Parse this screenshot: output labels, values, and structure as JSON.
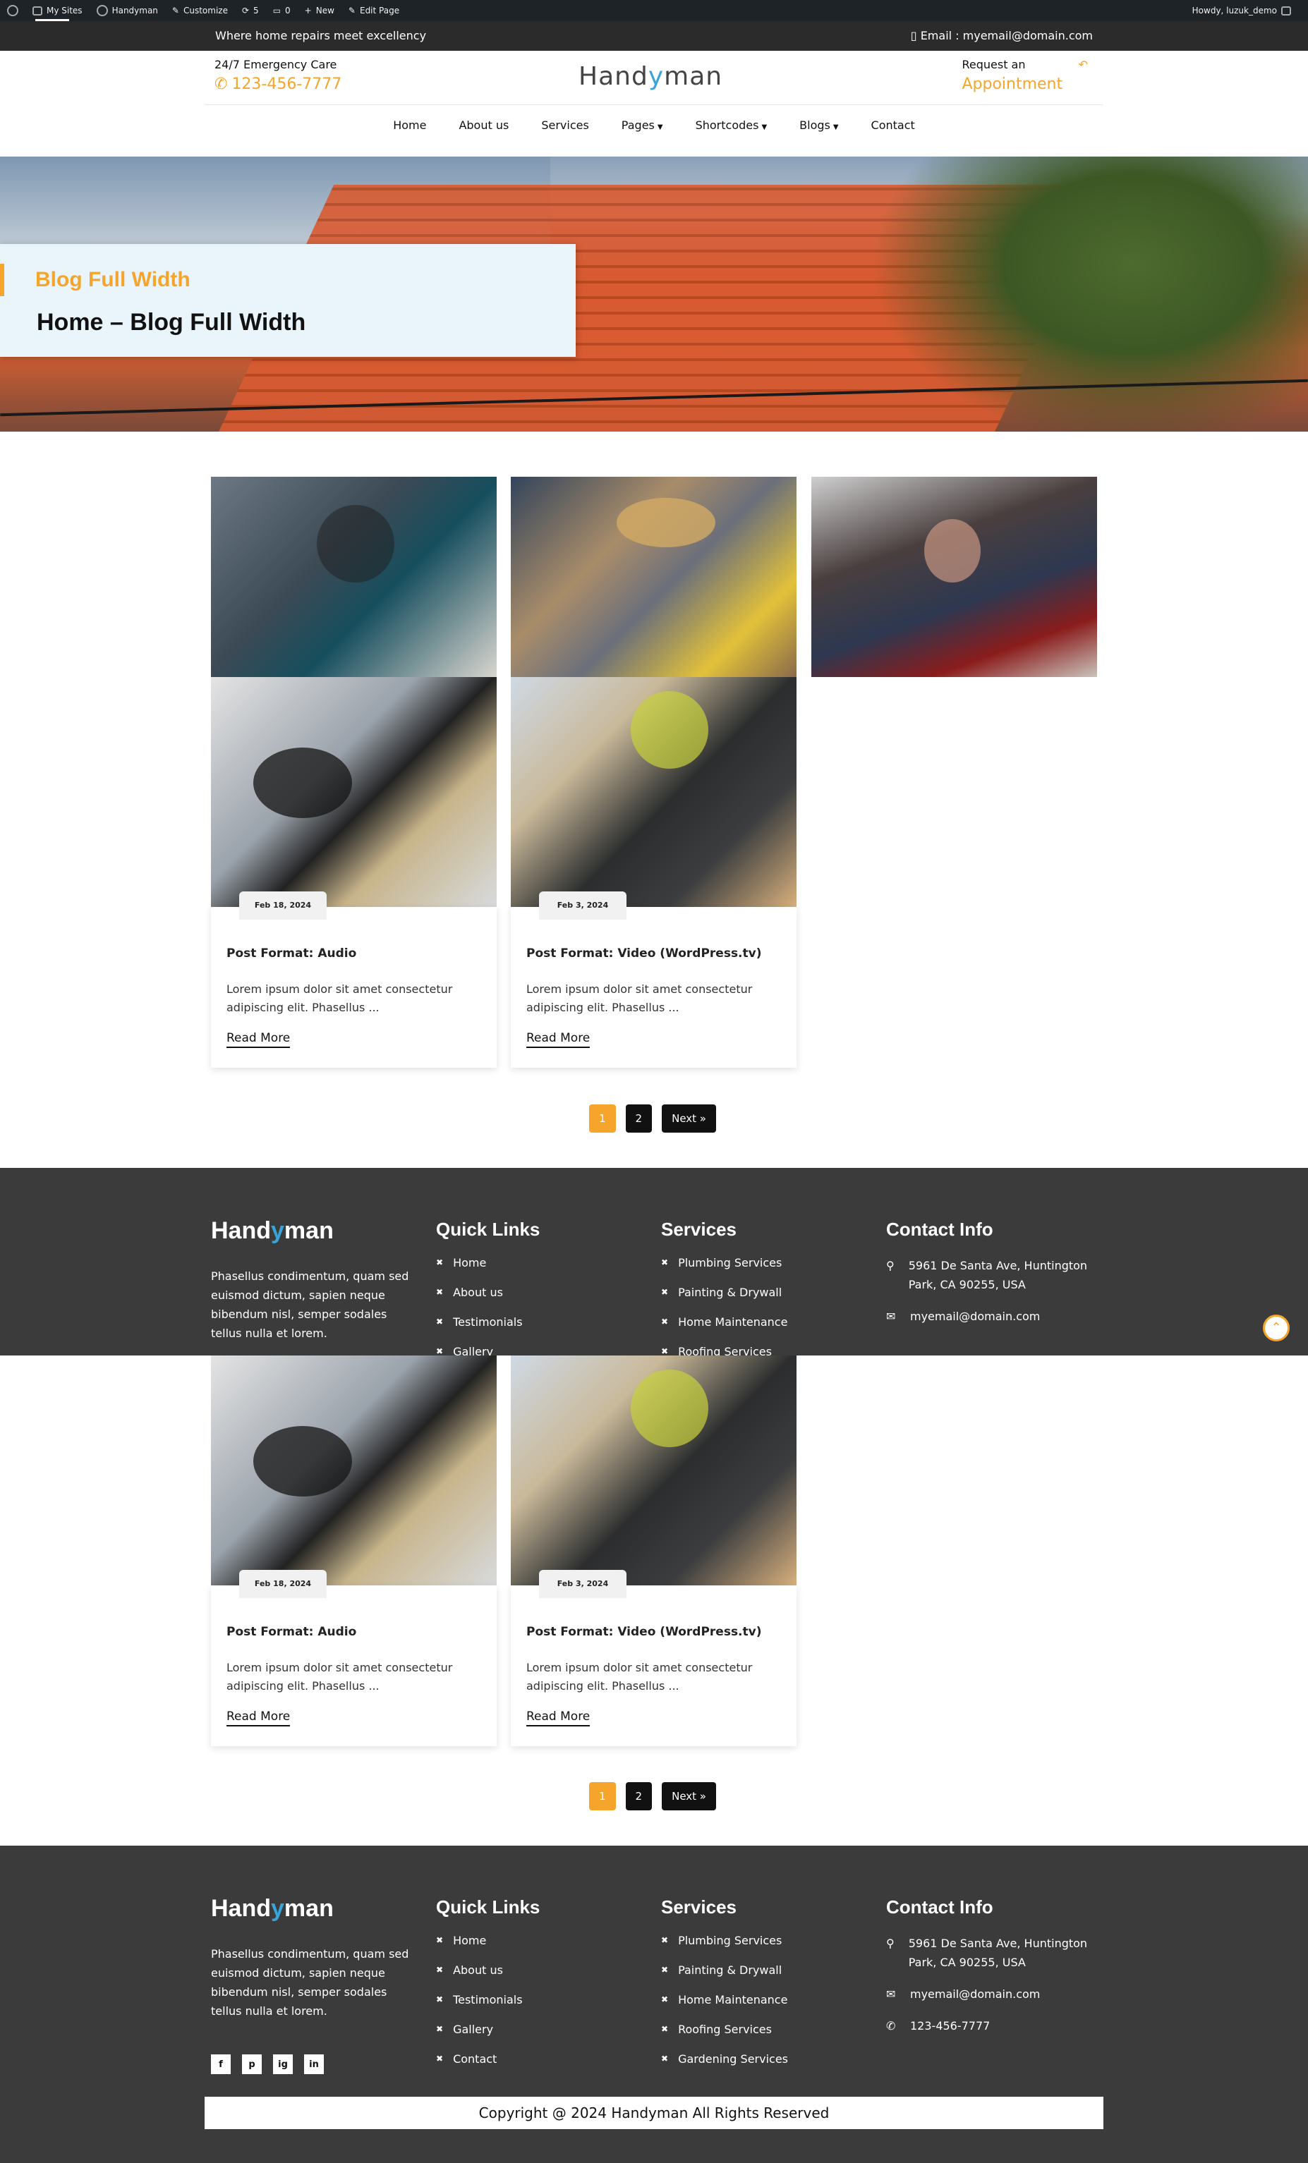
{
  "admin_bar": {
    "my_sites": "My Sites",
    "site_name": "Handyman",
    "customize": "Customize",
    "updates": "5",
    "comments": "0",
    "new": "New",
    "edit_page": "Edit Page",
    "howdy": "Howdy, luzuk_demo"
  },
  "topbar": {
    "tagline": "Where home repairs meet excellency",
    "email": "Email : myemail@domain.com"
  },
  "header": {
    "emergency_label": "24/7 Emergency Care",
    "phone": "123-456-7777",
    "logo_pre": "Hand",
    "logo_y": "y",
    "logo_post": "man",
    "request_label": "Request an",
    "appointment": "Appointment"
  },
  "nav": {
    "items": [
      {
        "label": "Home"
      },
      {
        "label": "About us"
      },
      {
        "label": "Services"
      },
      {
        "label": "Pages"
      },
      {
        "label": "Shortcodes"
      },
      {
        "label": "Blogs"
      },
      {
        "label": "Contact"
      }
    ]
  },
  "hero": {
    "subtitle": "Blog Full Width",
    "title": "Home –  Blog Full Width"
  },
  "posts": [
    {
      "date": "Feb 18, 2024",
      "title": "Post Format: Audio",
      "excerpt": "Lorem ipsum dolor sit amet consectetur adipiscing elit. Phasellus ...",
      "more": "Read More"
    },
    {
      "date": "Feb 3, 2024",
      "title": "Post Format: Video (WordPress.tv)",
      "excerpt": "Lorem ipsum dolor sit amet consectetur adipiscing elit. Phasellus ...",
      "more": "Read More"
    }
  ],
  "pagination": {
    "page1": "1",
    "page2": "2",
    "next": "Next »"
  },
  "footer": {
    "logo_pre": "Hand",
    "logo_y": "y",
    "logo_post": "man",
    "description": "Phasellus condimentum, quam sed euismod dictum, sapien neque bibendum nisl, semper sodales tellus nulla et lorem.",
    "quick_links_title": "Quick Links",
    "quick_links": [
      "Home",
      "About us",
      "Testimonials",
      "Gallery",
      "Contact"
    ],
    "services_title": "Services",
    "services": [
      "Plumbing Services",
      "Painting & Drywall",
      "Home Maintenance",
      "Roofing Services",
      "Gardening Services"
    ],
    "contact_title": "Contact Info",
    "address": "5961 De Santa Ave, Huntington Park, CA 90255, USA",
    "email": "myemail@domain.com",
    "phone": "123-456-7777",
    "socials": [
      "f",
      "p",
      "ig",
      "in"
    ],
    "copyright": "Copyright @ 2024 Handyman All Rights Reserved"
  },
  "colors": {
    "accent": "#f5a52c",
    "dark": "#3b3b3b",
    "logo_blue": "#3aa3d8"
  }
}
